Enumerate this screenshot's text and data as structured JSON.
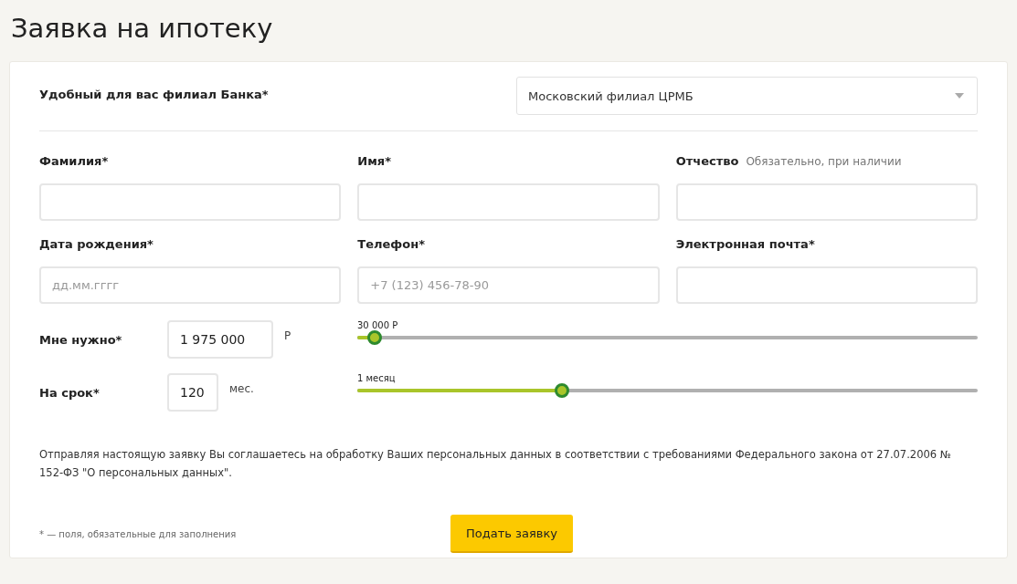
{
  "page_title": "Заявка на ипотеку",
  "branch": {
    "label": "Удобный для вас филиал Банка*",
    "value": "Московский филиал ЦРМБ"
  },
  "fields": [
    {
      "label": "Фамилия*"
    },
    {
      "label": "Имя*"
    },
    {
      "label": "Отчество",
      "hint": "Обязательно, при наличии"
    },
    {
      "label": "Дата рождения*",
      "placeholder": "дд.мм.гггг"
    },
    {
      "label": "Телефон*",
      "placeholder": "+7 (123) 456-78-90"
    },
    {
      "label": "Электронная почта*"
    }
  ],
  "amounts": [
    {
      "label": "Мне нужно*",
      "value": "1 975 000",
      "unit": "Р",
      "slider_label": "30 000 Р",
      "level": 0.028
    },
    {
      "label": "На срок*",
      "value": "120",
      "unit": "мес.",
      "slider_label": "1 месяц",
      "level": 0.33
    }
  ],
  "consent": "Отправляя настоящую заявку Вы соглашаетесь на обработку Ваших персональных данных в соответствии с требованиями Федерального закона от 27.07.2006 № 152-ФЗ \"О персональных данных\".",
  "footnote": "* — поля, обязательные для заполнения",
  "submit": "Подать заявку"
}
